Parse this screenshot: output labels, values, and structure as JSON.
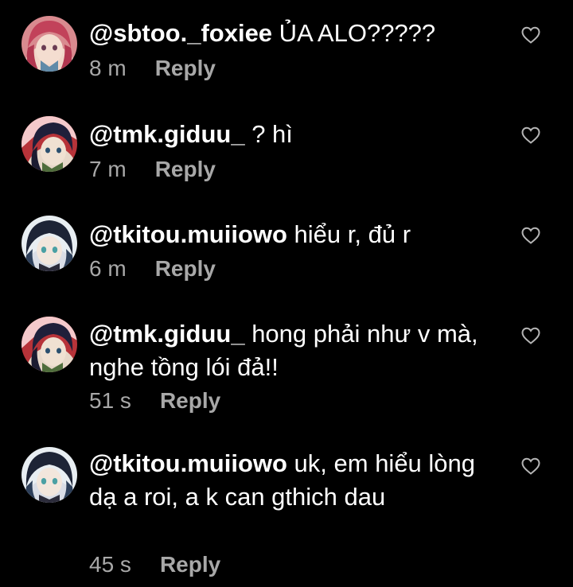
{
  "colors": {
    "background": "#000000",
    "text": "#ffffff",
    "meta": "#a8a8a8",
    "like_icon": "#b5b5b5"
  },
  "comments": [
    {
      "avatar_icon": "avatar-pink-hair",
      "username": "@sbtoo._foxiee",
      "text": " ỦA ALO?????",
      "time": "8 m",
      "reply_label": "Reply",
      "like_icon": "heart-outline-icon"
    },
    {
      "avatar_icon": "avatar-dark-hair-red",
      "username": "@tmk.giduu_",
      "text": " ? hì",
      "time": "7 m",
      "reply_label": "Reply",
      "like_icon": "heart-outline-icon"
    },
    {
      "avatar_icon": "avatar-dark-hair-teal",
      "username": "@tkitou.muiiowo",
      "text": " hiểu r, đủ r",
      "time": "6 m",
      "reply_label": "Reply",
      "like_icon": "heart-outline-icon"
    },
    {
      "avatar_icon": "avatar-dark-hair-red",
      "username": "@tmk.giduu_",
      "text": " hong phải như v mà, nghe tồng lói đả!!",
      "time": "51 s",
      "reply_label": "Reply",
      "like_icon": "heart-outline-icon"
    },
    {
      "avatar_icon": "avatar-dark-hair-teal",
      "username": "@tkitou.muiiowo",
      "text": " uk, em hiểu lòng dạ a roi, a k can gthich dau",
      "time": "45 s",
      "reply_label": "Reply",
      "like_icon": "heart-outline-icon"
    }
  ]
}
